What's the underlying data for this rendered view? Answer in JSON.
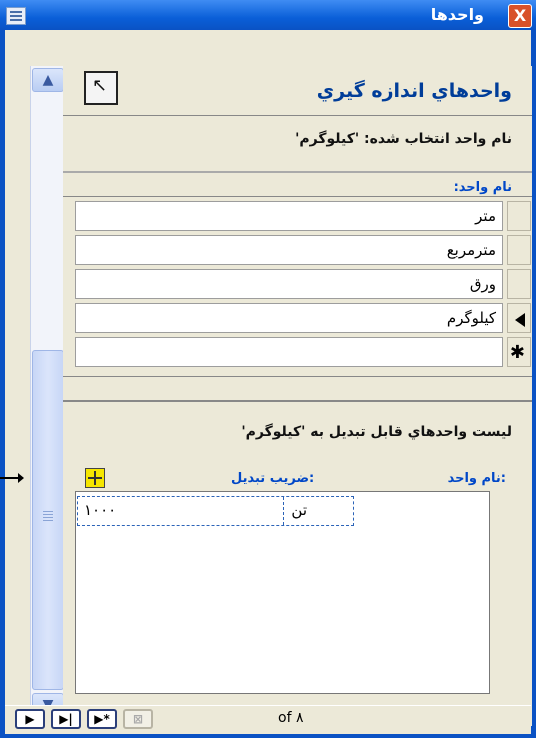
{
  "window": {
    "title": "واحدها",
    "close_label": "X"
  },
  "header": {
    "title": "واحدهاي اندازه گيري"
  },
  "selected_unit_label": "نام واحد انتخاب شده: 'کیلوگرم'",
  "units_table": {
    "column_header": "نام واحد:",
    "rows": [
      "متر",
      "مترمربع",
      "ورق",
      "کیلوگرم",
      ""
    ]
  },
  "conversion": {
    "list_label": "ليست واحدهاي قابل تبديل به 'کیلوگرم'",
    "col_unit_header": "نام واحد:",
    "col_factor_header": "ضریب تبدیل:",
    "rows": [
      {
        "unit": "تن",
        "factor": "۱۰۰۰"
      }
    ]
  },
  "navigation": {
    "next": "▶",
    "last": "▶|",
    "new": "▶*",
    "delete": "⊠",
    "record_of": "of ۸"
  },
  "icons": {
    "system_menu": "form-icon",
    "return": "return-arrow-icon",
    "subform_add": "crosshair-add-icon"
  }
}
